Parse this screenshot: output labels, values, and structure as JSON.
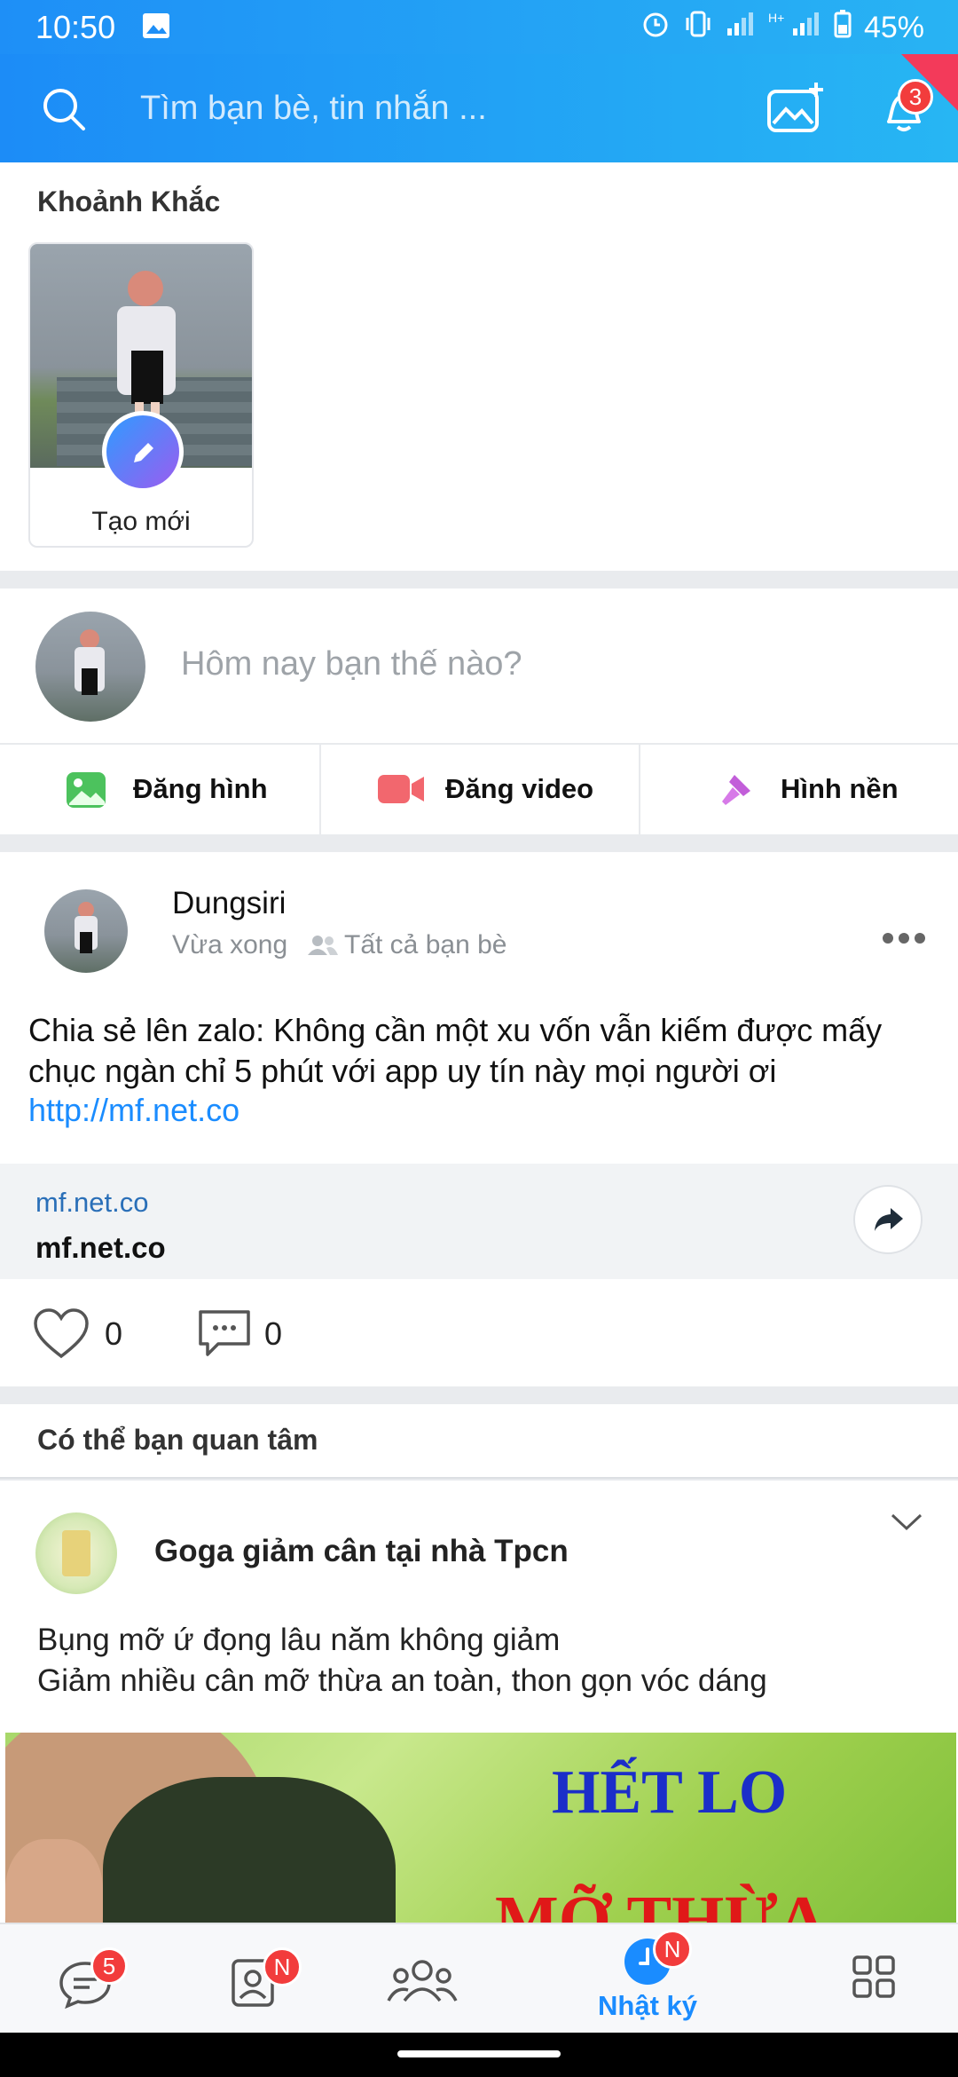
{
  "status_bar": {
    "time": "10:50",
    "battery": "45%"
  },
  "header": {
    "search_placeholder": "Tìm bạn bè, tin nhắn ...",
    "notification_count": "3"
  },
  "moments": {
    "title": "Khoảnh Khắc",
    "create_label": "Tạo mới"
  },
  "composer": {
    "placeholder": "Hôm nay bạn thế nào?",
    "actions": [
      "Đăng hình",
      "Đăng video",
      "Hình nền"
    ]
  },
  "post": {
    "author": "Dungsiri",
    "time": "Vừa xong",
    "audience": "Tất cả bạn bè",
    "text": "Chia sẻ lên zalo: Không cần một xu vốn vẫn kiếm được mấy chục ngàn chỉ 5 phút với app uy tín này mọi người ơi",
    "link": "http://mf.net.co",
    "preview_domain": "mf.net.co",
    "preview_title": "mf.net.co",
    "likes": "0",
    "comments": "0"
  },
  "suggested": {
    "section_title": "Có thể bạn quan tâm",
    "page_name": "Goga giảm cân tại nhà Tpcn",
    "line1": "Bụng mỡ ứ đọng lâu năm không giảm",
    "line2": "Giảm nhiều cân mỡ thừa an toàn, thon gọn vóc dáng",
    "ad_headline1": "HẾT LO",
    "ad_headline2": "MỠ THỪA"
  },
  "bottom_nav": {
    "messages_badge": "5",
    "contacts_badge": "N",
    "diary_badge": "N",
    "diary_label": "Nhật ký"
  },
  "colors": {
    "accent": "#1a8cff",
    "header_start": "#1c8cf7",
    "header_end": "#27b6f3",
    "badge": "#f23c3c"
  }
}
